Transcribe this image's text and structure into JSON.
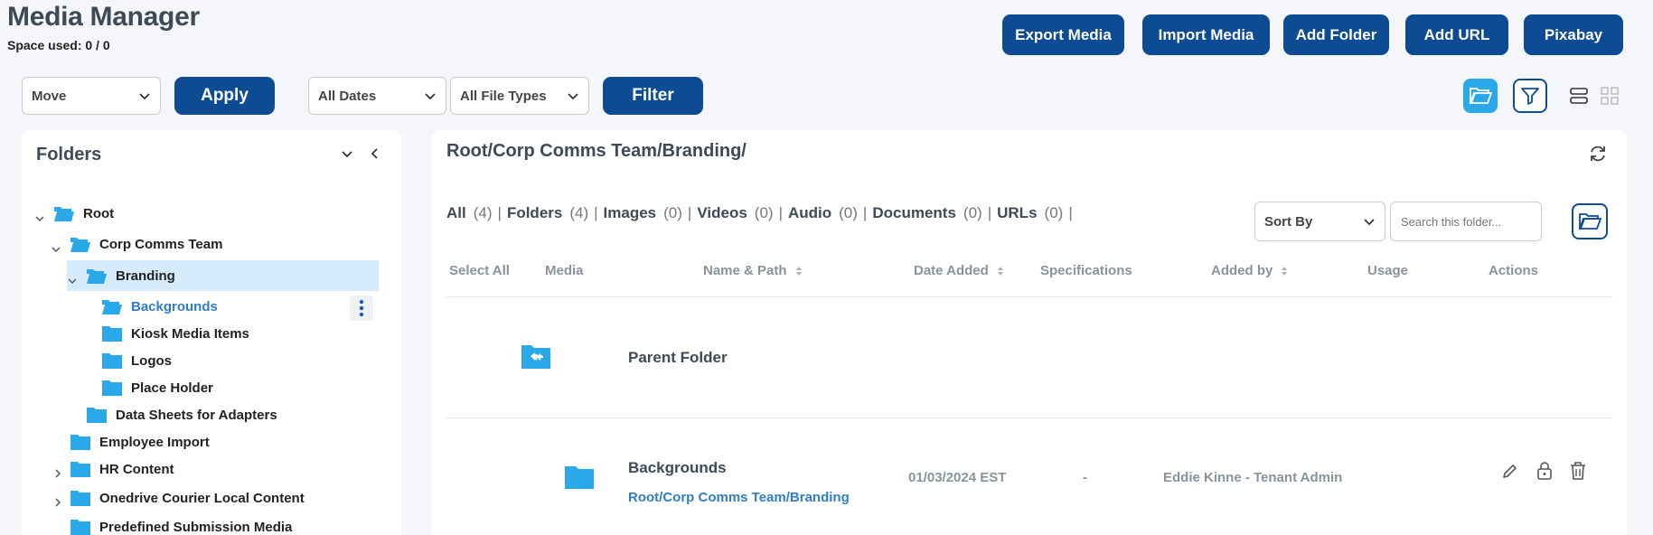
{
  "app": {
    "title": "Media Manager",
    "space_used": "Space used: 0 / 0"
  },
  "header_buttons": {
    "export": "Export Media",
    "import": "Import Media",
    "add_folder": "Add Folder",
    "add_url": "Add URL",
    "pixabay": "Pixabay"
  },
  "toolbar": {
    "bulk_action": "Move",
    "apply": "Apply",
    "dates": "All Dates",
    "file_types": "All File Types",
    "filter": "Filter"
  },
  "folders_panel": {
    "title": "Folders",
    "tree": [
      "Root",
      "Corp Comms Team",
      "Branding",
      "Backgrounds",
      "Kiosk Media Items",
      "Logos",
      "Place Holder",
      "Data Sheets for Adapters",
      "Employee Import",
      "HR Content",
      "Onedrive Courier Local Content",
      "Predefined Submission Media"
    ]
  },
  "main": {
    "path": "Root/Corp Comms Team/Branding/",
    "filters": [
      {
        "label": "All",
        "count": "(4)"
      },
      {
        "label": "Folders",
        "count": "(4)"
      },
      {
        "label": "Images",
        "count": "(0)"
      },
      {
        "label": "Videos",
        "count": "(0)"
      },
      {
        "label": "Audio",
        "count": "(0)"
      },
      {
        "label": "Documents",
        "count": "(0)"
      },
      {
        "label": "URLs",
        "count": "(0)"
      }
    ],
    "separator": "|",
    "sort_by": "Sort By",
    "search_placeholder": "Search this folder...",
    "columns": {
      "select_all": "Select All",
      "media": "Media",
      "name_path": "Name & Path",
      "date_added": "Date Added",
      "specifications": "Specifications",
      "added_by": "Added by",
      "usage": "Usage",
      "actions": "Actions"
    },
    "parent_folder": "Parent Folder",
    "rows": [
      {
        "name": "Backgrounds",
        "path": "Root/Corp Comms Team/Branding",
        "date": "01/03/2024 EST",
        "specs": "-",
        "added_by": "Eddie Kinne - Tenant Admin"
      }
    ]
  },
  "colors": {
    "primary": "#0d4c93",
    "folder": "#29a9ea",
    "selected_row": "#d6ebfb",
    "link": "#2f7dc9"
  }
}
